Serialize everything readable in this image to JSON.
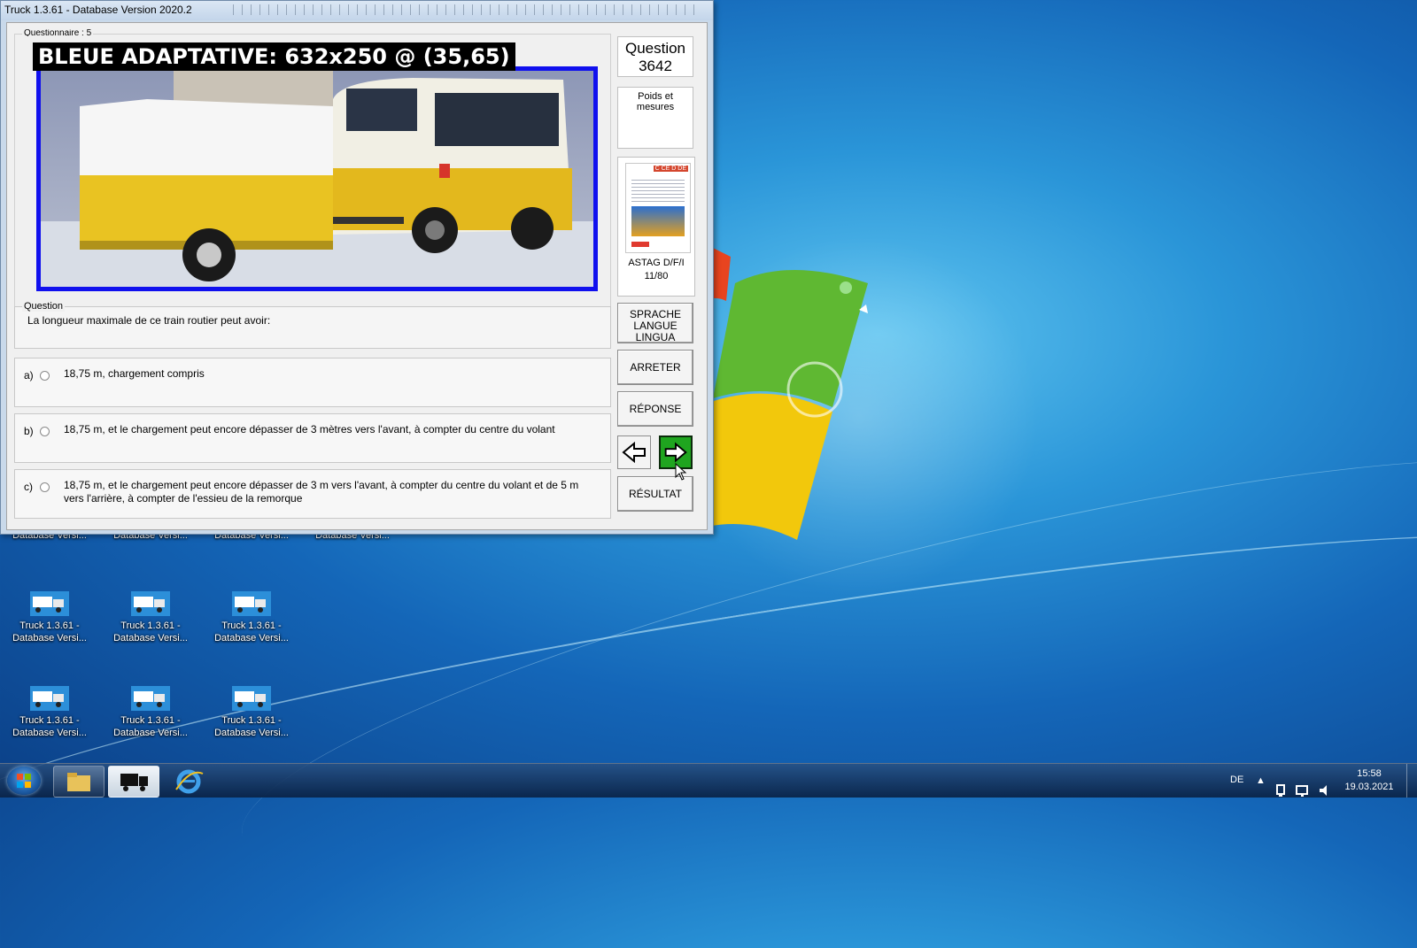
{
  "window": {
    "title": "Truck 1.3.61 - Database Version 2020.2"
  },
  "quiz": {
    "questionnaire_label": "Questionnaire : 5",
    "overlay_label": "BLEUE ADAPTATIVE: 632x250 @ (35,65)",
    "question_number_label": "Question",
    "question_number": "3642",
    "category": "Poids et mesures",
    "book": {
      "caption_line1": "ASTAG D/F/I",
      "caption_line2": "11/80",
      "cover_badge": "C CE D DE"
    },
    "question_group_label": "Question",
    "question_text": "La longueur maximale de ce train routier peut avoir:",
    "answers": [
      {
        "letter": "a)",
        "text": "18,75 m, chargement compris"
      },
      {
        "letter": "b)",
        "text": "18,75 m, et le chargement peut encore dépasser de 3 mètres vers l'avant, à compter du centre du volant"
      },
      {
        "letter": "c)",
        "text": "18,75 m, et le chargement peut encore dépasser de 3 m vers l'avant, à compter du centre du volant et de 5 m vers l'arrière, à compter de l'essieu de la remorque"
      }
    ]
  },
  "buttons": {
    "lang_line1": "SPRACHE",
    "lang_line2": "LANGUE",
    "lang_line3": "LINGUA",
    "stop": "ARRETER",
    "answer": "RÉPONSE",
    "result": "RÉSULTAT"
  },
  "desktop": {
    "icon_label_line1": "Truck 1.3.61 -",
    "icon_label_line2": "Database Versi..."
  },
  "taskbar": {
    "language": "DE",
    "time": "15:58",
    "date": "19.03.2021"
  },
  "colors": {
    "overlay_border": "#1010ee",
    "next_button": "#1fa51f"
  }
}
